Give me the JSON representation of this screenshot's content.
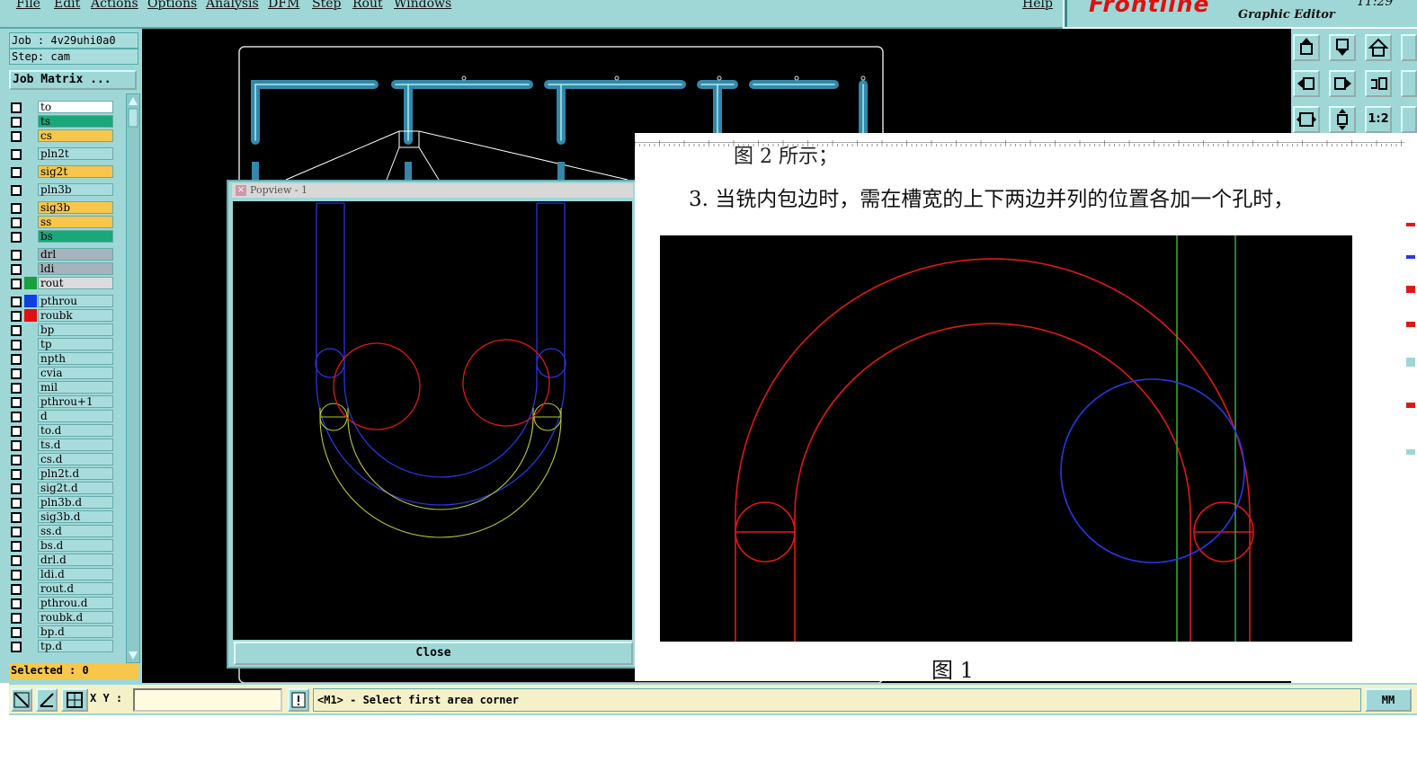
{
  "menu": {
    "items": [
      "File",
      "Edit",
      "Actions",
      "Options",
      "Analysis",
      "DFM",
      "Step",
      "Rout",
      "Windows"
    ],
    "help": "Help"
  },
  "brand": {
    "logo": "Frontline",
    "subtitle": "Graphic Editor",
    "clock": "11:29"
  },
  "job": {
    "job_line": "Job : 4v29uhi0a0",
    "step_line": "Step: cam",
    "matrix_button": "Job Matrix ..."
  },
  "layers": [
    {
      "name": "to",
      "color": "#ffffff",
      "swatch": null,
      "gap": false
    },
    {
      "name": "ts",
      "color": "#1aa87a",
      "swatch": null,
      "gap": false
    },
    {
      "name": "cs",
      "color": "#f7c64a",
      "swatch": null,
      "gap": false
    },
    {
      "name": "pln2t",
      "color": "#a9dddd",
      "swatch": null,
      "gap": true
    },
    {
      "name": "sig2t",
      "color": "#f7c64a",
      "swatch": null,
      "gap": true
    },
    {
      "name": "pln3b",
      "color": "#a9dddd",
      "swatch": null,
      "gap": true
    },
    {
      "name": "sig3b",
      "color": "#f7c64a",
      "swatch": null,
      "gap": true
    },
    {
      "name": "ss",
      "color": "#f7c64a",
      "swatch": null,
      "gap": false
    },
    {
      "name": "bs",
      "color": "#1aa87a",
      "swatch": null,
      "gap": false
    },
    {
      "name": "drl",
      "color": "#a6b2bc",
      "swatch": null,
      "gap": true
    },
    {
      "name": "ldi",
      "color": "#a6b2bc",
      "swatch": null,
      "gap": false
    },
    {
      "name": "rout",
      "color": "#dcdcdc",
      "swatch": "#1aa040",
      "gap": false
    },
    {
      "name": "pthrou",
      "color": "#a9dddd",
      "swatch": "#1040e0",
      "gap": true
    },
    {
      "name": "roubk",
      "color": "#a9dddd",
      "swatch": "#e01010",
      "gap": false
    },
    {
      "name": "bp",
      "color": "#a9dddd",
      "swatch": null,
      "gap": false
    },
    {
      "name": "tp",
      "color": "#a9dddd",
      "swatch": null,
      "gap": false
    },
    {
      "name": "npth",
      "color": "#a9dddd",
      "swatch": null,
      "gap": false
    },
    {
      "name": "cvia",
      "color": "#a9dddd",
      "swatch": null,
      "gap": false
    },
    {
      "name": "mil",
      "color": "#a9dddd",
      "swatch": null,
      "gap": false
    },
    {
      "name": "pthrou+1",
      "color": "#a9dddd",
      "swatch": null,
      "gap": false
    },
    {
      "name": "d",
      "color": "#a9dddd",
      "swatch": null,
      "gap": false
    },
    {
      "name": "to.d",
      "color": "#a9dddd",
      "swatch": null,
      "gap": false
    },
    {
      "name": "ts.d",
      "color": "#a9dddd",
      "swatch": null,
      "gap": false
    },
    {
      "name": "cs.d",
      "color": "#a9dddd",
      "swatch": null,
      "gap": false
    },
    {
      "name": "pln2t.d",
      "color": "#a9dddd",
      "swatch": null,
      "gap": false
    },
    {
      "name": "sig2t.d",
      "color": "#a9dddd",
      "swatch": null,
      "gap": false
    },
    {
      "name": "pln3b.d",
      "color": "#a9dddd",
      "swatch": null,
      "gap": false
    },
    {
      "name": "sig3b.d",
      "color": "#a9dddd",
      "swatch": null,
      "gap": false
    },
    {
      "name": "ss.d",
      "color": "#a9dddd",
      "swatch": null,
      "gap": false
    },
    {
      "name": "bs.d",
      "color": "#a9dddd",
      "swatch": null,
      "gap": false
    },
    {
      "name": "drl.d",
      "color": "#a9dddd",
      "swatch": null,
      "gap": false
    },
    {
      "name": "ldi.d",
      "color": "#a9dddd",
      "swatch": null,
      "gap": false
    },
    {
      "name": "rout.d",
      "color": "#a9dddd",
      "swatch": null,
      "gap": false
    },
    {
      "name": "pthrou.d",
      "color": "#a9dddd",
      "swatch": null,
      "gap": false
    },
    {
      "name": "roubk.d",
      "color": "#a9dddd",
      "swatch": null,
      "gap": false
    },
    {
      "name": "bp.d",
      "color": "#a9dddd",
      "swatch": null,
      "gap": false
    },
    {
      "name": "tp.d",
      "color": "#a9dddd",
      "swatch": null,
      "gap": false
    }
  ],
  "selected": "Selected : 0",
  "popview": {
    "title": "Popview - 1",
    "close_label": "Close"
  },
  "toolbar": {
    "ratio_label": "1:2"
  },
  "document": {
    "heading": "图 2 所示；",
    "paragraph": "3. 当铣内包边时，需在槽宽的上下两边并列的位置各加一个孔时，",
    "caption": "图 1"
  },
  "statusbar": {
    "xy_label": "X Y :",
    "xy_value": "",
    "message": "<M1> - Select first area corner",
    "units": "MM"
  }
}
